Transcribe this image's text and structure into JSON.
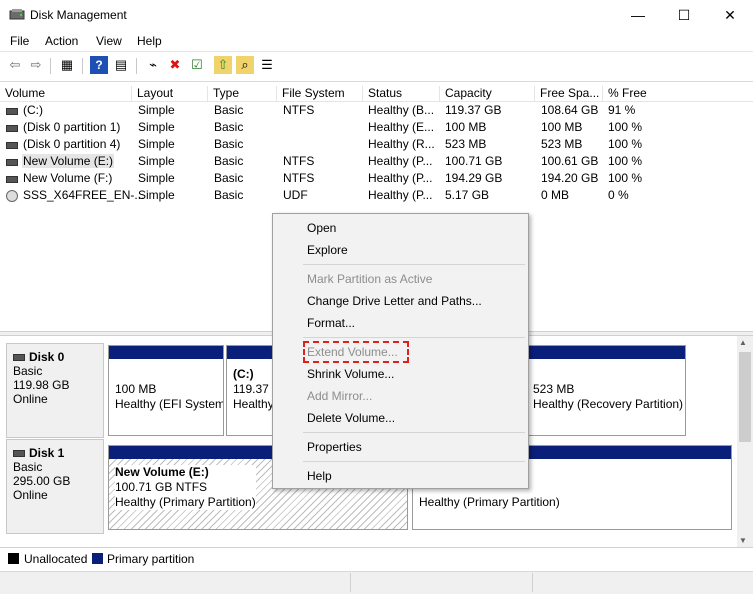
{
  "window": {
    "title": "Disk Management",
    "minimize_glyph": "—",
    "maximize_glyph": "☐",
    "close_glyph": "✕"
  },
  "menubar": [
    "File",
    "Action",
    "View",
    "Help"
  ],
  "toolbar": {
    "icons": [
      "back-icon",
      "forward-icon",
      "show-hide-icon",
      "help-icon",
      "properties-icon",
      "connect-drive-icon",
      "delete-icon",
      "checklist-icon",
      "import-icon",
      "search-icon",
      "settings-icon"
    ],
    "glyphs": [
      "⇦",
      "⇨",
      "▦",
      "?",
      "▤",
      "⌁",
      "✖",
      "☑",
      "⇧",
      "⌕",
      "☰"
    ]
  },
  "colors": {
    "primary_partition": "#0a1f7a",
    "unallocated": "#000000",
    "highlight": "#e0201a"
  },
  "volume_table": {
    "columns": [
      "Volume",
      "Layout",
      "Type",
      "File System",
      "Status",
      "Capacity",
      "Free Spa...",
      "% Free"
    ],
    "rows": [
      {
        "volume": "(C:)",
        "layout": "Simple",
        "type": "Basic",
        "fs": "NTFS",
        "status": "Healthy (B...",
        "capacity": "119.37 GB",
        "free": "108.64 GB",
        "pct": "91 %"
      },
      {
        "volume": "(Disk 0 partition 1)",
        "layout": "Simple",
        "type": "Basic",
        "fs": "",
        "status": "Healthy (E...",
        "capacity": "100 MB",
        "free": "100 MB",
        "pct": "100 %"
      },
      {
        "volume": "(Disk 0 partition 4)",
        "layout": "Simple",
        "type": "Basic",
        "fs": "",
        "status": "Healthy (R...",
        "capacity": "523 MB",
        "free": "523 MB",
        "pct": "100 %"
      },
      {
        "volume": "New Volume (E:)",
        "layout": "Simple",
        "type": "Basic",
        "fs": "NTFS",
        "status": "Healthy (P...",
        "capacity": "100.71 GB",
        "free": "100.61 GB",
        "pct": "100 %"
      },
      {
        "volume": "New Volume (F:)",
        "layout": "Simple",
        "type": "Basic",
        "fs": "NTFS",
        "status": "Healthy (P...",
        "capacity": "194.29 GB",
        "free": "194.20 GB",
        "pct": "100 %"
      },
      {
        "volume": "SSS_X64FREE_EN-...",
        "layout": "Simple",
        "type": "Basic",
        "fs": "UDF",
        "status": "Healthy (P...",
        "capacity": "5.17 GB",
        "free": "0 MB",
        "pct": "0 %"
      }
    ]
  },
  "disks": [
    {
      "name": "Disk 0",
      "type": "Basic",
      "size": "119.98 GB",
      "state": "Online",
      "partitions": [
        {
          "title": "",
          "size": "100 MB",
          "status": "Healthy (EFI System"
        },
        {
          "title": "(C:)",
          "size": "119.37 G",
          "status": "Healthy"
        },
        {
          "title": "",
          "size": "523 MB",
          "status": "Healthy (Recovery Partition)"
        }
      ]
    },
    {
      "name": "Disk 1",
      "type": "Basic",
      "size": "295.00 GB",
      "state": "Online",
      "partitions": [
        {
          "title": "New Volume  (E:)",
          "size": "100.71 GB NTFS",
          "status": "Healthy (Primary Partition)"
        },
        {
          "title": "",
          "size": "",
          "status": "Healthy (Primary Partition)"
        }
      ]
    }
  ],
  "legend": [
    {
      "label": "Unallocated",
      "color": "#000000"
    },
    {
      "label": "Primary partition",
      "color": "#0a1f7a"
    }
  ],
  "context_menu": {
    "open": "Open",
    "explore": "Explore",
    "mark_active": "Mark Partition as Active",
    "change_letter": "Change Drive Letter and Paths...",
    "format": "Format...",
    "extend": "Extend Volume...",
    "shrink": "Shrink Volume...",
    "add_mirror": "Add Mirror...",
    "delete": "Delete Volume...",
    "properties": "Properties",
    "help": "Help"
  },
  "scrollbar": {
    "up_glyph": "▲",
    "down_glyph": "▼"
  }
}
